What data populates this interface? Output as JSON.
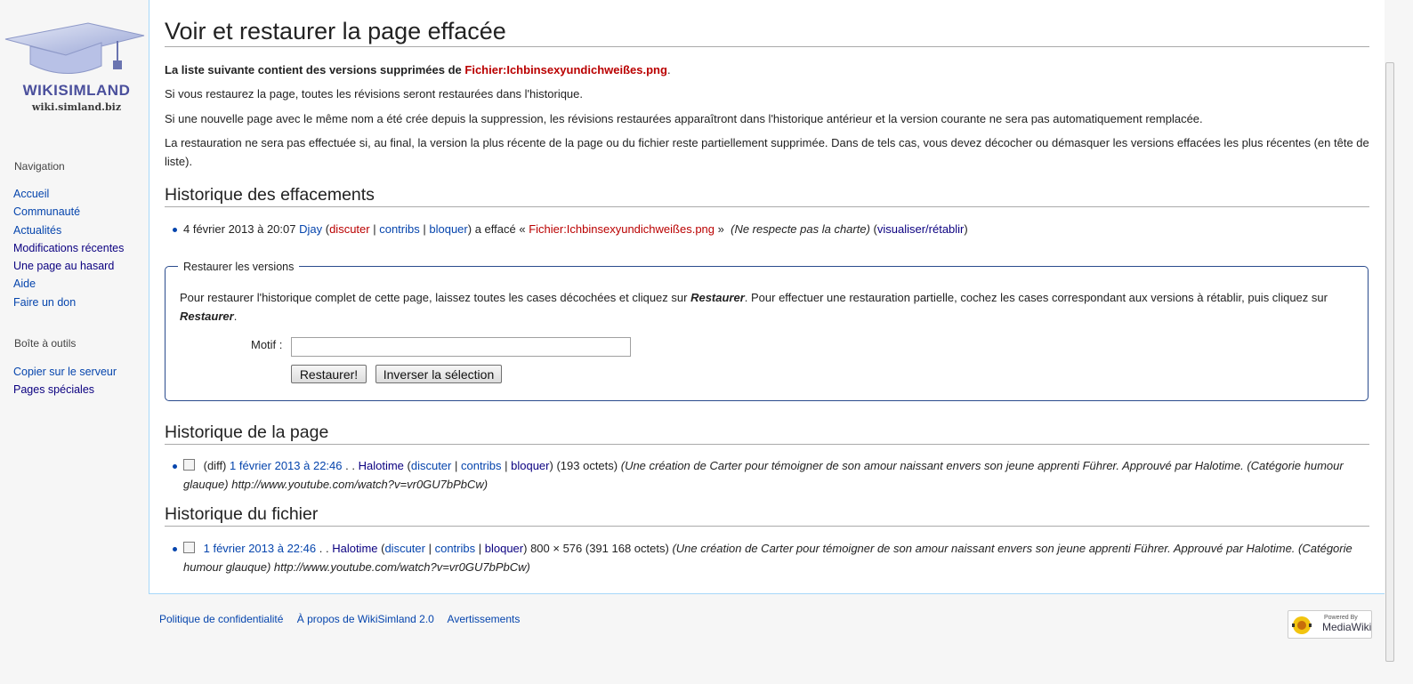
{
  "logo": {
    "name": "WIKISIMLAND",
    "url": "wiki.simland.biz"
  },
  "sidebar": {
    "navigation_heading": "Navigation",
    "navigation": [
      "Accueil",
      "Communauté",
      "Actualités",
      "Modifications récentes",
      "Une page au hasard",
      "Aide",
      "Faire un don"
    ],
    "tools_heading": "Boîte à outils",
    "tools": [
      "Copier sur le serveur",
      "Pages spéciales"
    ]
  },
  "page": {
    "title": "Voir et restaurer la page effacée",
    "intro_bold": "La liste suivante contient des versions supprimées de ",
    "file_link": "Fichier:Ichbinsexyundichweißes.png",
    "p1": "Si vous restaurez la page, toutes les révisions seront restaurées dans l'historique.",
    "p2": "Si une nouvelle page avec le même nom a été crée depuis la suppression, les révisions restaurées apparaîtront dans l'historique antérieur et la version courante ne sera pas automatiquement remplacée.",
    "p3": "La restauration ne sera pas effectuée si, au final, la version la plus récente de la page ou du fichier reste partiellement supprimée. Dans de tels cas, vous devez décocher ou démasquer les versions effacées les plus récentes (en tête de liste)."
  },
  "deletion_log": {
    "heading": "Historique des effacements",
    "date": "4 février 2013 à 20:07",
    "user": "Djay",
    "talk": "discuter",
    "contribs": "contribs",
    "block": "bloquer",
    "action": "a effacé «",
    "file": "Fichier:Ichbinsexyundichweißes.png",
    "close_quote": "»",
    "reason": "(Ne respecte pas la charte)",
    "view": "visualiser/rétablir"
  },
  "restore_box": {
    "legend": "Restaurer les versions",
    "instructions_a": "Pour restaurer l'historique complet de cette page, laissez toutes les cases décochées et cliquez sur ",
    "restore_word": "Restaurer",
    "instructions_b": ". Pour effectuer une restauration partielle, cochez les cases correspondant aux versions à rétablir, puis cliquez sur ",
    "motif_label": "Motif :",
    "motif_value": "",
    "restore_button": "Restaurer!",
    "invert_button": "Inverser la sélection"
  },
  "page_history": {
    "heading": "Historique de la page",
    "diff": "(diff)",
    "date": "1 février 2013 à 22:46",
    "dots": ". .",
    "user": "Halotime",
    "talk": "discuter",
    "contribs": "contribs",
    "block": "bloquer",
    "size": "(193 octets)",
    "comment": "(Une création de Carter pour témoigner de son amour naissant envers son jeune apprenti Führer. Approuvé par Halotime. (Catégorie humour glauque) http://www.youtube.com/watch?v=vr0GU7bPbCw)"
  },
  "file_history": {
    "heading": "Historique du fichier",
    "date": "1 février 2013 à 22:46",
    "dots": ". .",
    "user": "Halotime",
    "talk": "discuter",
    "contribs": "contribs",
    "block": "bloquer",
    "size": "800 × 576 (391 168 octets)",
    "comment": "(Une création de Carter pour témoigner de son amour naissant envers son jeune apprenti Führer. Approuvé par Halotime. (Catégorie humour glauque) http://www.youtube.com/watch?v=vr0GU7bPbCw)"
  },
  "footer": {
    "links": [
      "Politique de confidentialité",
      "À propos de WikiSimland 2.0",
      "Avertissements"
    ],
    "badge_top": "Powered By",
    "badge_main": "MediaWiki"
  }
}
